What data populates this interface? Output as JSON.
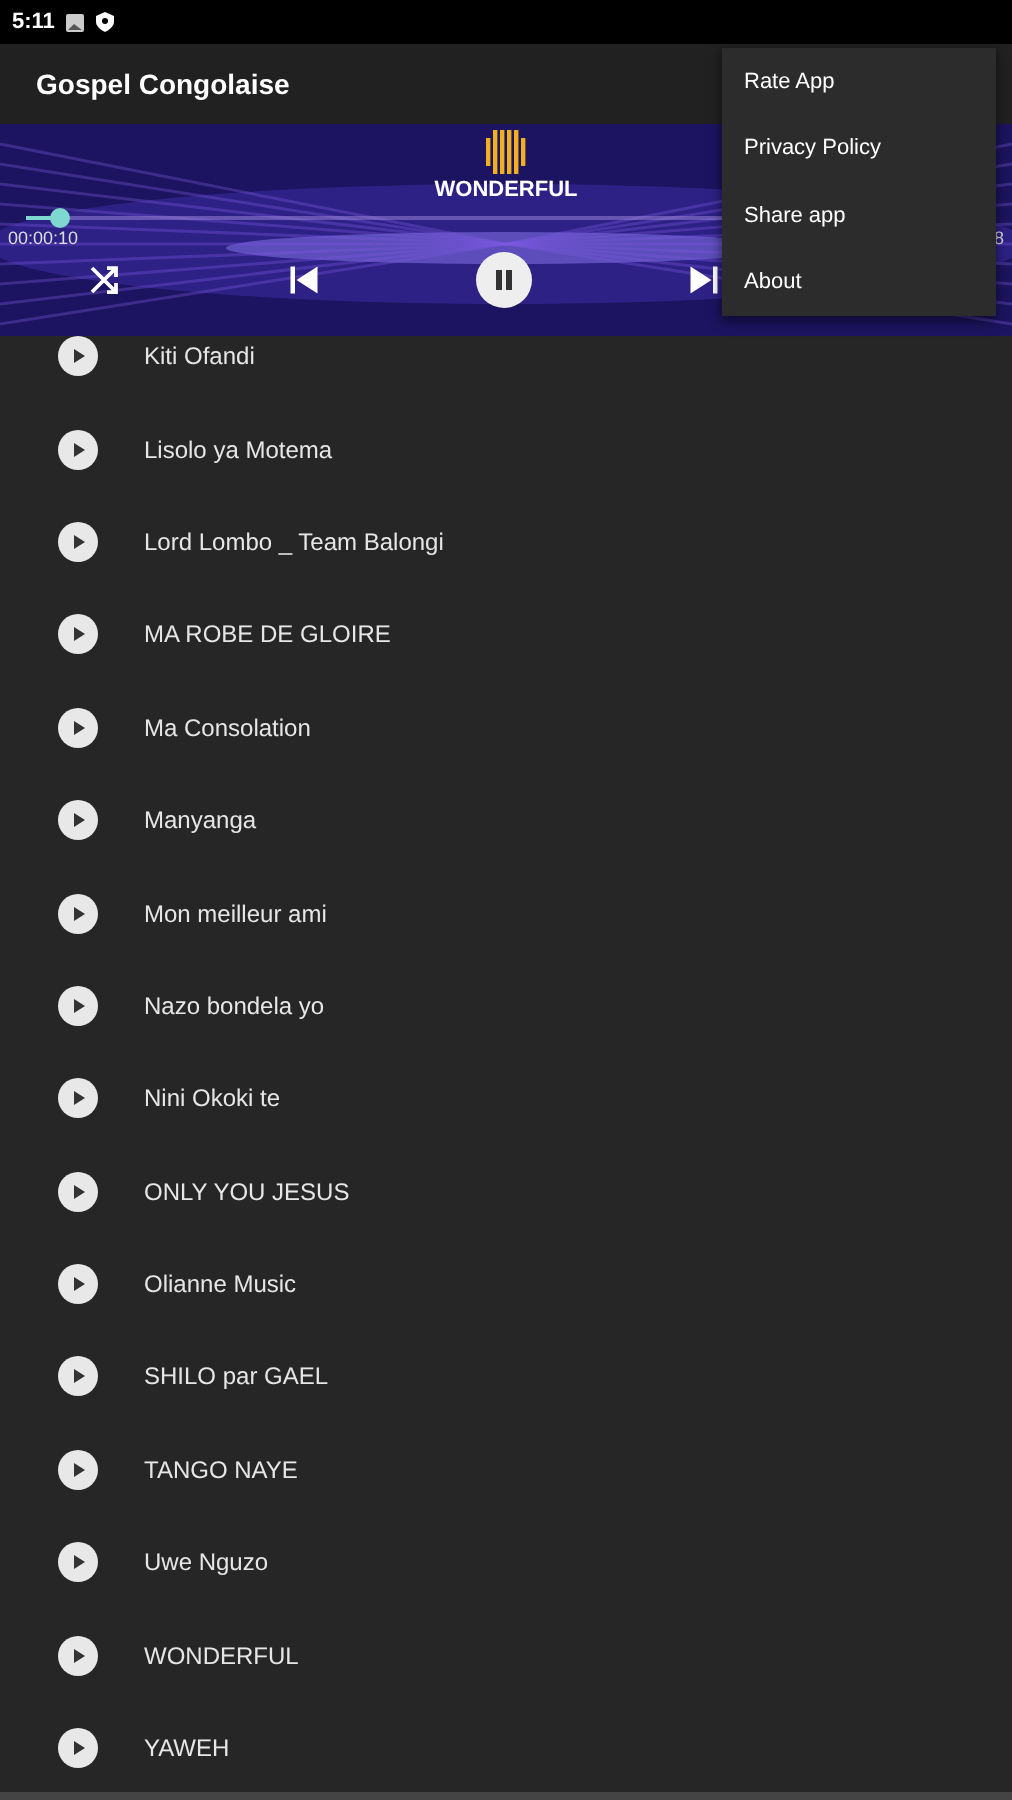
{
  "status_bar": {
    "time": "5:11"
  },
  "toolbar": {
    "title": "Gospel Congolaise"
  },
  "player": {
    "track": "WONDERFUL",
    "elapsed": "00:00:10",
    "total": "8",
    "progress": {
      "level": 0.035
    },
    "playing": true
  },
  "menu": [
    "Rate App",
    "Privacy Policy",
    "Share app",
    "About"
  ],
  "songs": [
    "Kiti Ofandi",
    "Lisolo ya Motema",
    "Lord Lombo _ Team Balongi",
    "MA ROBE DE GLOIRE",
    "Ma Consolation",
    "Manyanga",
    "Mon meilleur ami",
    "Nazo bondela yo",
    "Nini Okoki te",
    "ONLY YOU JESUS",
    "Olianne Music",
    "SHILO par GAEL",
    "TANGO NAYE",
    "Uwe Nguzo",
    "WONDERFUL",
    "YAWEH"
  ]
}
